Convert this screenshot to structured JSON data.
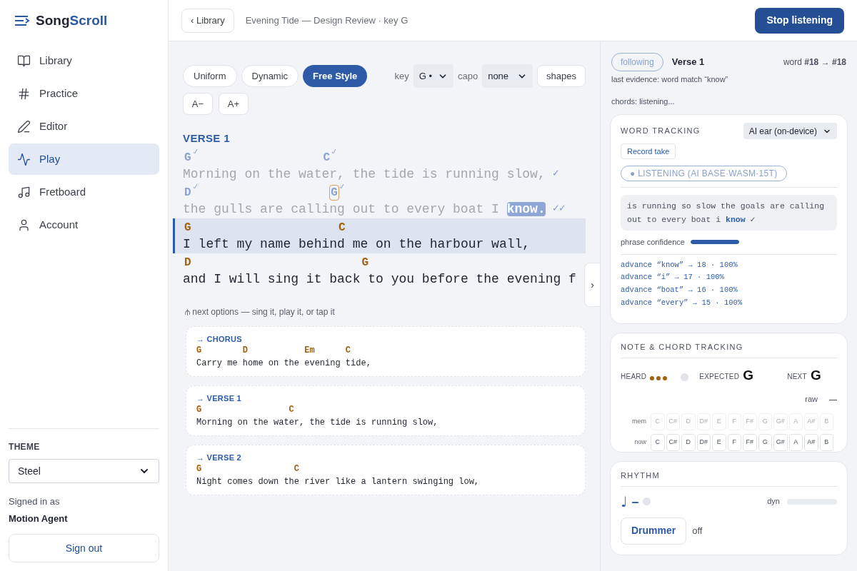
{
  "brand": {
    "first": "Song",
    "second": "Scroll"
  },
  "nav": [
    {
      "label": "Library",
      "selected": false
    },
    {
      "label": "Practice",
      "selected": false
    },
    {
      "label": "Editor",
      "selected": false
    },
    {
      "label": "Play",
      "selected": true
    },
    {
      "label": "Fretboard",
      "selected": false
    },
    {
      "label": "Account",
      "selected": false
    }
  ],
  "theme": {
    "label": "THEME",
    "value": "Steel"
  },
  "account": {
    "caption": "Signed in as",
    "name": "Motion Agent",
    "sign_out": "Sign out"
  },
  "topbar": {
    "back": "‹ Library",
    "title": "Evening Tide — Design Review · key G",
    "stop": "Stop listening"
  },
  "modes": [
    {
      "label": "Uniform",
      "selected": false
    },
    {
      "label": "Dynamic",
      "selected": false
    },
    {
      "label": "Free Style",
      "selected": true
    }
  ],
  "key": {
    "label": "key",
    "value": "G •"
  },
  "capo": {
    "label": "capo",
    "value": "none"
  },
  "shapes": "shapes",
  "font_buttons": [
    "A−",
    "A+"
  ],
  "section": "VERSE 1",
  "lines": [
    {
      "sung": true,
      "current": false,
      "parts": [
        {
          "chord": {
            "name": "G",
            "heard": true,
            "pending": false
          },
          "text": "Morning on the wat"
        },
        {
          "chord": {
            "name": "C",
            "heard": true,
            "pending": false
          },
          "text": "er, the tide is running slow,"
        }
      ],
      "mark": "✓"
    },
    {
      "sung": true,
      "current": false,
      "parts": [
        {
          "chord": {
            "name": "D",
            "heard": true,
            "pending": false
          },
          "text": "the gulls are calli"
        },
        {
          "chord": {
            "name": "G",
            "heard": true,
            "pending": true
          },
          "text": "ng out to every boat I "
        }
      ],
      "current_word": "know.",
      "mark": "✓✓"
    },
    {
      "sung": false,
      "current": true,
      "parts": [
        {
          "chord": {
            "name": "G",
            "heard": false,
            "pending": false
          },
          "text": "I left my name behin"
        },
        {
          "chord": {
            "name": "C",
            "heard": false,
            "pending": false
          },
          "text": "d me on the harbour wall,"
        }
      ]
    },
    {
      "sung": false,
      "current": false,
      "parts": [
        {
          "chord": {
            "name": "D",
            "heard": false,
            "pending": false
          },
          "text": "and I will sing it back"
        },
        {
          "chord": {
            "name": "G",
            "heard": false,
            "pending": false
          },
          "text": " to you before the evening f"
        }
      ]
    }
  ],
  "collapse": "›",
  "next_hint": "⫛ next options — sing it, play it, or tap it",
  "next_options": [
    {
      "label": "→ CHORUS",
      "parts": [
        {
          "chord": "G",
          "text": "Carry me "
        },
        {
          "chord": "D",
          "text": "home on the "
        },
        {
          "chord": "Em",
          "text": "evening "
        },
        {
          "chord": "C",
          "text": "tide,"
        }
      ]
    },
    {
      "label": "→ VERSE 1",
      "parts": [
        {
          "chord": "G",
          "text": "Morning on the wat"
        },
        {
          "chord": "C",
          "text": "er, the tide is running slow,"
        }
      ]
    },
    {
      "label": "→ VERSE 2",
      "parts": [
        {
          "chord": "G",
          "text": "Night comes down th"
        },
        {
          "chord": "C",
          "text": "e river like a lantern swinging low,"
        }
      ]
    }
  ],
  "status": {
    "mode": "following",
    "section": "Verse 1",
    "word": "word **#18** → **#18**",
    "evidence": "last evidence: word match “know”",
    "chords": "chords: listening..."
  },
  "word_tracking": {
    "title": "WORD TRACKING",
    "engine": "AI ear (on-device)",
    "record": "Record take",
    "listening": "● LISTENING (AI BASE·WASM·15T)",
    "transcript": "is running so slow the goals are calling out to every boat i **know** ✓",
    "confidence_label": "phrase confidence",
    "confidence": {
      "level": 1
    },
    "log": [
      "advance “know” → 18 · 100%",
      "advance “i” → 17 · 100%",
      "advance “boat” → 16 · 100%",
      "advance “every” → 15 · 100%"
    ]
  },
  "note_tracking": {
    "title": "NOTE & CHORD TRACKING",
    "heard_label": "HEARD",
    "detected": false,
    "expected_label": "EXPECTED",
    "expected": "G",
    "next_label": "NEXT",
    "next": "G",
    "raw_label": "raw",
    "raw": "—",
    "rows": [
      {
        "label": "mem",
        "active": false,
        "notes": [
          "C",
          "C#",
          "D",
          "D#",
          "E",
          "F",
          "F#",
          "G",
          "G#",
          "A",
          "A#",
          "B"
        ]
      },
      {
        "label": "now",
        "active": true,
        "notes": [
          "C",
          "C#",
          "D",
          "D#",
          "E",
          "F",
          "F#",
          "G",
          "G#",
          "A",
          "A#",
          "B"
        ]
      }
    ]
  },
  "rhythm": {
    "title": "RHYTHM",
    "note": "♩",
    "beat": "–",
    "pulse": false,
    "dyn_label": "dyn",
    "dyn": {
      "level": 0
    },
    "drummer": "Drummer",
    "drummer_state": "off"
  }
}
